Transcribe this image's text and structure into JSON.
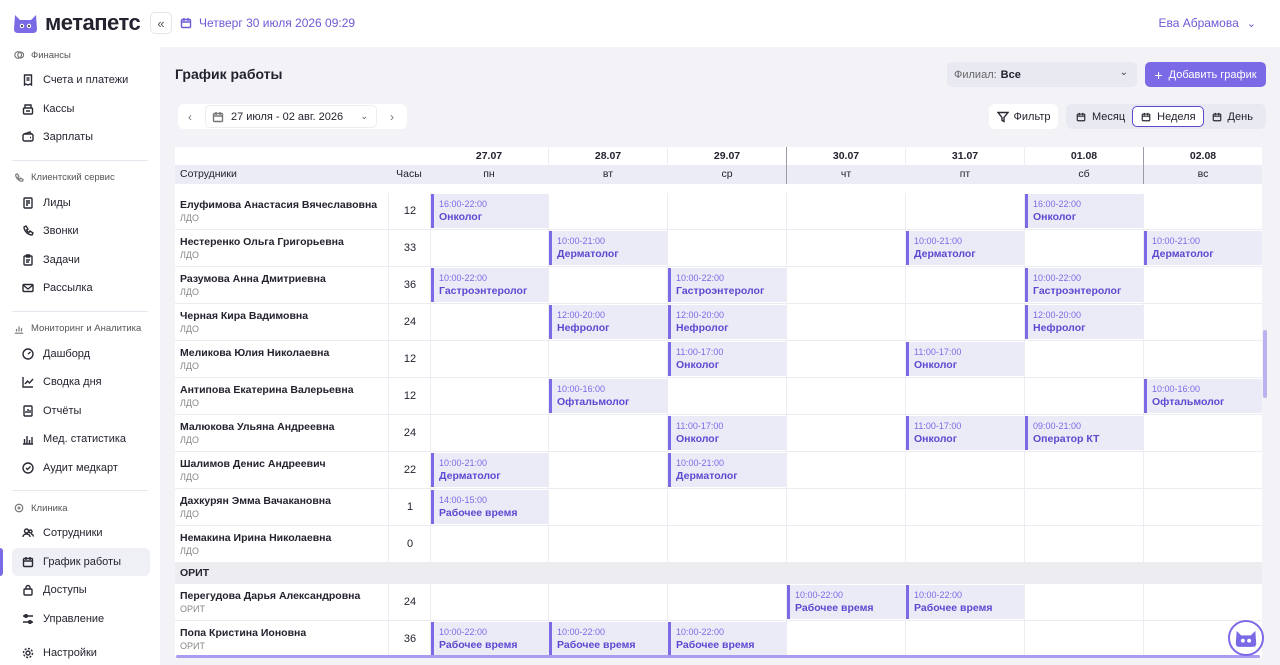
{
  "app": {
    "logo_text": "метапетс"
  },
  "header": {
    "datetime": "Четверг 30 июля 2026 09:29",
    "user": "Ева Абрамова"
  },
  "sidebar": {
    "sections": [
      {
        "title": "Финансы",
        "icon": "coins-icon",
        "items": [
          {
            "label": "Счета и платежи",
            "icon": "receipt-icon"
          },
          {
            "label": "Кассы",
            "icon": "cash-register-icon"
          },
          {
            "label": "Зарплаты",
            "icon": "wallet-icon"
          }
        ]
      },
      {
        "title": "Клиентский сервис",
        "icon": "phone-icon",
        "items": [
          {
            "label": "Лиды",
            "icon": "document-icon"
          },
          {
            "label": "Звонки",
            "icon": "phone-icon"
          },
          {
            "label": "Задачи",
            "icon": "clipboard-icon"
          },
          {
            "label": "Рассылка",
            "icon": "mail-icon"
          }
        ]
      },
      {
        "title": "Мониторинг и Аналитика",
        "icon": "chart-icon",
        "items": [
          {
            "label": "Дашборд",
            "icon": "gauge-icon"
          },
          {
            "label": "Сводка дня",
            "icon": "line-chart-icon"
          },
          {
            "label": "Отчёты",
            "icon": "report-icon"
          },
          {
            "label": "Мед. статистика",
            "icon": "bar-chart-icon"
          },
          {
            "label": "Аудит медкарт",
            "icon": "audit-icon"
          }
        ]
      },
      {
        "title": "Клиника",
        "icon": "clinic-icon",
        "items": [
          {
            "label": "Сотрудники",
            "icon": "users-icon"
          },
          {
            "label": "График работы",
            "icon": "calendar-icon",
            "active": true
          },
          {
            "label": "Доступы",
            "icon": "lock-icon"
          },
          {
            "label": "Управление",
            "icon": "sliders-icon"
          }
        ]
      }
    ],
    "settings": {
      "label": "Настройки",
      "icon": "gear-icon"
    }
  },
  "page": {
    "title": "График работы",
    "branch_label": "Филиал:",
    "branch_value": "Все",
    "add_button": "Добавить график",
    "date_range": "27 июля - 02 авг. 2026",
    "filter": "Фильтр",
    "views": [
      "Месяц",
      "Неделя",
      "День"
    ],
    "active_view": "Неделя"
  },
  "table": {
    "col_employees": "Сотрудники",
    "col_hours": "Часы",
    "days": [
      {
        "date": "27.07",
        "dow": "пн"
      },
      {
        "date": "28.07",
        "dow": "вт"
      },
      {
        "date": "29.07",
        "dow": "ср"
      },
      {
        "date": "30.07",
        "dow": "чт"
      },
      {
        "date": "31.07",
        "dow": "пт"
      },
      {
        "date": "01.08",
        "dow": "сб"
      },
      {
        "date": "02.08",
        "dow": "вс"
      }
    ],
    "groups": [
      {
        "name": "",
        "rows": [
          {
            "name": "Елуфимова Анастасия Вячеславовна",
            "dept": "ЛДО",
            "hours": "12",
            "shifts": [
              {
                "day": 0,
                "time": "16:00-22:00",
                "spec": "Онколог"
              },
              {
                "day": 5,
                "time": "16:00-22:00",
                "spec": "Онколог"
              }
            ]
          },
          {
            "name": "Нестеренко Ольга Григорьевна",
            "dept": "ЛДО",
            "hours": "33",
            "shifts": [
              {
                "day": 1,
                "time": "10:00-21:00",
                "spec": "Дерматолог"
              },
              {
                "day": 4,
                "time": "10:00-21:00",
                "spec": "Дерматолог"
              },
              {
                "day": 6,
                "time": "10:00-21:00",
                "spec": "Дерматолог"
              }
            ]
          },
          {
            "name": "Разумова Анна Дмитриевна",
            "dept": "ЛДО",
            "hours": "36",
            "shifts": [
              {
                "day": 0,
                "time": "10:00-22:00",
                "spec": "Гастроэнтеролог"
              },
              {
                "day": 2,
                "time": "10:00-22:00",
                "spec": "Гастроэнтеролог"
              },
              {
                "day": 5,
                "time": "10:00-22:00",
                "spec": "Гастроэнтеролог"
              }
            ]
          },
          {
            "name": "Черная Кира Вадимовна",
            "dept": "ЛДО",
            "hours": "24",
            "shifts": [
              {
                "day": 1,
                "time": "12:00-20:00",
                "spec": "Нефролог"
              },
              {
                "day": 2,
                "time": "12:00-20:00",
                "spec": "Нефролог"
              },
              {
                "day": 5,
                "time": "12:00-20:00",
                "spec": "Нефролог"
              }
            ]
          },
          {
            "name": "Меликова Юлия Николаевна",
            "dept": "ЛДО",
            "hours": "12",
            "shifts": [
              {
                "day": 2,
                "time": "11:00-17:00",
                "spec": "Онколог"
              },
              {
                "day": 4,
                "time": "11:00-17:00",
                "spec": "Онколог"
              }
            ]
          },
          {
            "name": "Антипова Екатерина Валерьевна",
            "dept": "ЛДО",
            "hours": "12",
            "shifts": [
              {
                "day": 1,
                "time": "10:00-16:00",
                "spec": "Офтальмолог"
              },
              {
                "day": 6,
                "time": "10:00-16:00",
                "spec": "Офтальмолог"
              }
            ]
          },
          {
            "name": "Малюкова Ульяна Андреевна",
            "dept": "ЛДО",
            "hours": "24",
            "shifts": [
              {
                "day": 2,
                "time": "11:00-17:00",
                "spec": "Онколог"
              },
              {
                "day": 4,
                "time": "11:00-17:00",
                "spec": "Онколог"
              },
              {
                "day": 5,
                "time": "09:00-21:00",
                "spec": "Оператор КТ"
              }
            ]
          },
          {
            "name": "Шалимов Денис Андреевич",
            "dept": "ЛДО",
            "hours": "22",
            "shifts": [
              {
                "day": 0,
                "time": "10:00-21:00",
                "spec": "Дерматолог"
              },
              {
                "day": 2,
                "time": "10:00-21:00",
                "spec": "Дерматолог"
              }
            ]
          },
          {
            "name": "Дахкурян Эмма Вачакановна",
            "dept": "ЛДО",
            "hours": "1",
            "shifts": [
              {
                "day": 0,
                "time": "14:00-15:00",
                "spec": "Рабочее время"
              }
            ]
          },
          {
            "name": "Немакина Ирина Николаевна",
            "dept": "ЛДО",
            "hours": "0",
            "shifts": []
          }
        ]
      },
      {
        "name": "ОРИТ",
        "rows": [
          {
            "name": "Перегудова Дарья Александровна",
            "dept": "ОРИТ",
            "hours": "24",
            "shifts": [
              {
                "day": 3,
                "time": "10:00-22:00",
                "spec": "Рабочее время"
              },
              {
                "day": 4,
                "time": "10:00-22:00",
                "spec": "Рабочее время"
              }
            ]
          },
          {
            "name": "Попа Кристина Ионовна",
            "dept": "ОРИТ",
            "hours": "36",
            "shifts": [
              {
                "day": 0,
                "time": "10:00-22:00",
                "spec": "Рабочее время"
              },
              {
                "day": 1,
                "time": "10:00-22:00",
                "spec": "Рабочее время"
              },
              {
                "day": 2,
                "time": "10:00-22:00",
                "spec": "Рабочее время"
              }
            ]
          }
        ]
      }
    ]
  },
  "colors": {
    "accent": "#7b6ae6",
    "accent_dark": "#5a4ad0",
    "shift_bg": "#ebebf8"
  }
}
